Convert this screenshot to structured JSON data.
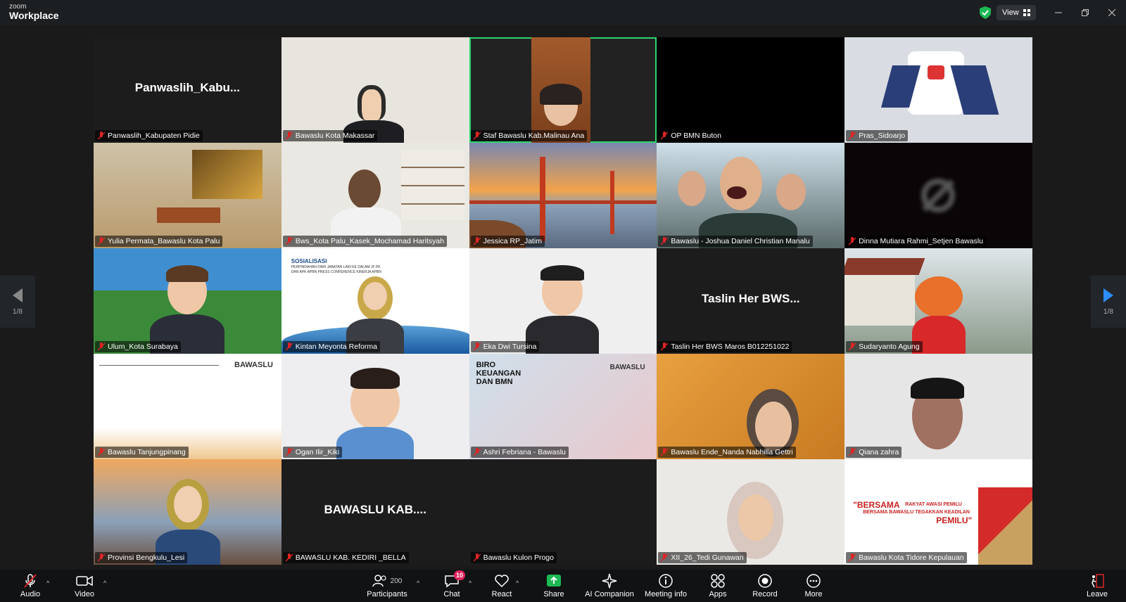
{
  "app": {
    "brand_small": "zoom",
    "brand_large": "Workplace"
  },
  "header": {
    "view_label": "View"
  },
  "pagination": {
    "left": "1/8",
    "right": "1/8"
  },
  "tiles": [
    {
      "name": "Panwaslih_Kabupaten Pidie",
      "big": "Panwaslih_Kabu..."
    },
    {
      "name": "Bawaslu Kota Makassar",
      "big": ""
    },
    {
      "name": "Staf Bawaslu Kab.Malinau Ana",
      "big": ""
    },
    {
      "name": "OP BMN Buton",
      "big": ""
    },
    {
      "name": "Pras_Sidoarjo",
      "big": ""
    },
    {
      "name": "Yulia Permata_Bawaslu Kota Palu",
      "big": ""
    },
    {
      "name": "Bws_Kota Palu_Kasek_Mochamad Haritsyah",
      "big": ""
    },
    {
      "name": "Jessica RP_Jatim",
      "big": ""
    },
    {
      "name": "Bawaslu - Joshua Daniel Christian Manalu",
      "big": ""
    },
    {
      "name": "Dinna Mutiara Rahmi_Setjen Bawaslu",
      "big": ""
    },
    {
      "name": "Ulum_Kota Surabaya",
      "big": ""
    },
    {
      "name": "Kintan Meyonta Reforma",
      "big": ""
    },
    {
      "name": "Eka Dwi Tursina",
      "big": ""
    },
    {
      "name": "Taslin Her BWS Maros B012251022",
      "big": "Taslin Her BWS..."
    },
    {
      "name": "Sudaryanto Agung",
      "big": ""
    },
    {
      "name": "Bawaslu Tanjungpinang",
      "big": ""
    },
    {
      "name": "Ogan Ilir_Kiki",
      "big": ""
    },
    {
      "name": "Ashri Febriana - Bawaslu",
      "big": ""
    },
    {
      "name": "Bawaslu Ende_Nanda Nabhilla Gettri",
      "big": ""
    },
    {
      "name": "Qiana zahra",
      "big": ""
    },
    {
      "name": "Provinsi Bengkulu_Lesi",
      "big": ""
    },
    {
      "name": "BAWASLU KAB. KEDIRI _BELLA",
      "big": "BAWASLU  KAB...."
    },
    {
      "name": "Bawaslu Kulon Progo",
      "big": ""
    },
    {
      "name": "XII_26_Tedi Gunawan",
      "big": ""
    },
    {
      "name": "Bawaslu Kota Tidore Kepulauan",
      "big": ""
    }
  ],
  "slides": {
    "kintan_title": "SOSIALISASI",
    "kintan_sub": "PERPINDAHAN DARI JABATAN LAIN KE DALAM JF PK DAN APK APBN PRESS CONFERENCE KINERJA APBN",
    "bawaslu_logo": "BAWASLU",
    "biro": "BIRO KEUANGAN DAN BMN",
    "tidore_1": "\"BERSAMA",
    "tidore_2": "RAKYAT AWASI PEMILU",
    "tidore_3": "BERSAMA BAWASLU TEGAKKAN KEADILAN",
    "tidore_4": "PEMILU\""
  },
  "toolbar": {
    "audio": "Audio",
    "video": "Video",
    "participants": "Participants",
    "participants_count": "200",
    "chat": "Chat",
    "chat_badge": "10",
    "react": "React",
    "share": "Share",
    "ai": "AI Companion",
    "meeting_info": "Meeting info",
    "apps": "Apps",
    "record": "Record",
    "more": "More",
    "leave": "Leave"
  },
  "colors": {
    "active_speaker": "#2dd36f",
    "share_green": "#1db954",
    "mute_red": "#e02424",
    "accent_blue": "#2d8cff"
  }
}
